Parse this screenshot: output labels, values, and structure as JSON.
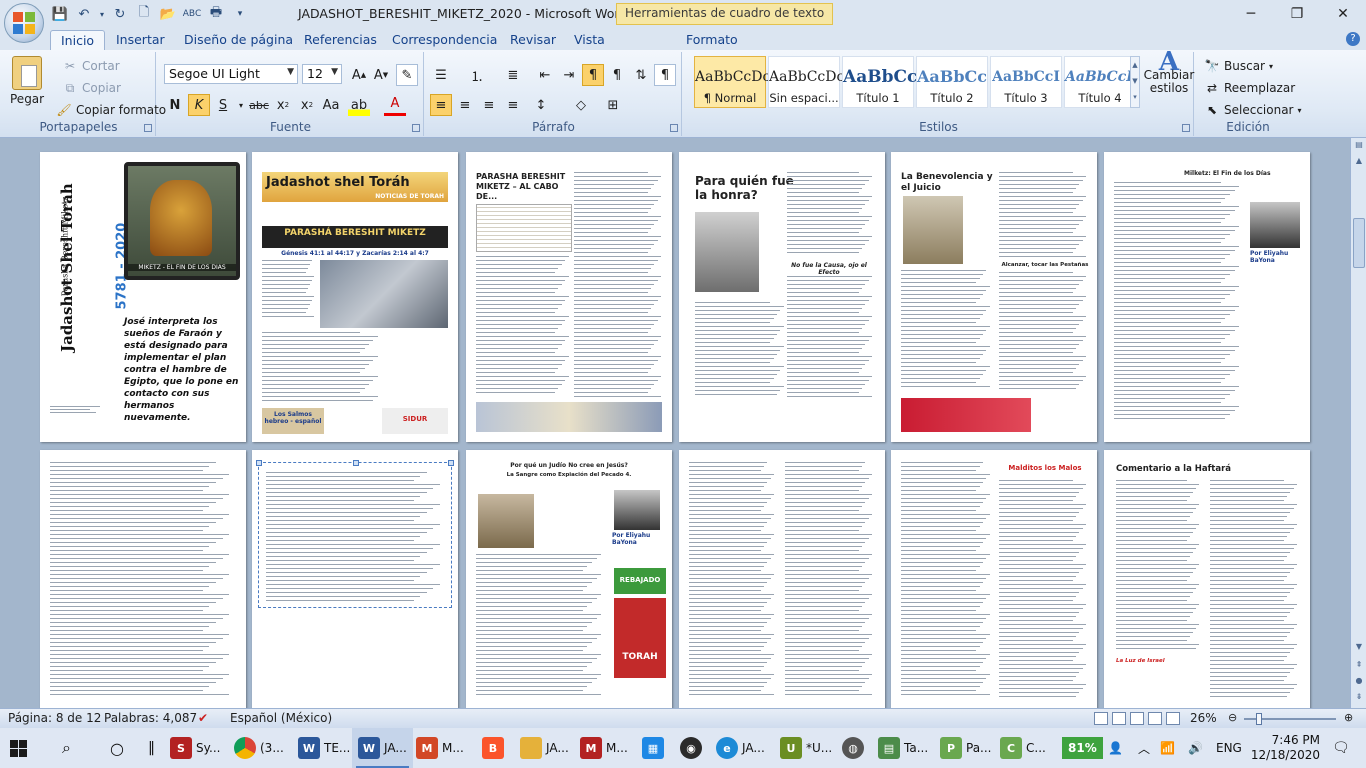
{
  "window": {
    "title": "JADASHOT_BERESHIT_MIKETZ_2020 - Microsoft Word",
    "context_tab_title": "Herramientas de cuadro de texto"
  },
  "tabs": [
    "Inicio",
    "Insertar",
    "Diseño de página",
    "Referencias",
    "Correspondencia",
    "Revisar",
    "Vista",
    "Formato"
  ],
  "ribbon": {
    "clipboard": {
      "label": "Portapapeles",
      "paste": "Pegar",
      "cut": "Cortar",
      "copy": "Copiar",
      "format_painter": "Copiar formato"
    },
    "font": {
      "label": "Fuente",
      "font_name": "Segoe UI Light",
      "font_size": "12"
    },
    "paragraph": {
      "label": "Párrafo"
    },
    "styles": {
      "label": "Estilos",
      "items": [
        {
          "sample": "AaBbCcDc",
          "name": "¶ Normal"
        },
        {
          "sample": "AaBbCcDc",
          "name": "Sin espaci..."
        },
        {
          "sample": "AaBbCc",
          "name": "Título 1"
        },
        {
          "sample": "AaBbCc",
          "name": "Título 2"
        },
        {
          "sample": "AaBbCcI",
          "name": "Título 3"
        },
        {
          "sample": "AaBbCcD",
          "name": "Título 4"
        }
      ],
      "change_styles": "Cambiar estilos"
    },
    "editing": {
      "label": "Edición",
      "find": "Buscar",
      "replace": "Reemplazar",
      "select": "Seleccionar"
    }
  },
  "pages": {
    "p1": {
      "title": "Jadashot Shel Torah",
      "subtitle": "Parasha Bereshit Miketz",
      "year": "5781 - 2020",
      "band": "MIKETZ - EL FIN DE LOS DIAS",
      "caption": "José interpreta los sueños de Faraón y está designado para implementar el plan contra el hambre de Egipto, que lo pone en contacto con sus hermanos nuevamente."
    },
    "p2": {
      "title": "Jadashot shel Toráh",
      "noticias": "NOTICIAS DE TORAH",
      "parasha": "PARASHÁ BERESHIT MIKETZ",
      "ref": "Génesis 41:1 al 44:17 y Zacarías 2:14 al 4:7",
      "ad1": "Los Salmos hebreo - español",
      "ad2": "SIDUR"
    },
    "p3": {
      "title": "PARASHA BERESHIT MIKETZ – AL CABO DE..."
    },
    "p4": {
      "title": "Para quién fue la honra?",
      "sub": "No fue la Causa, ojo el Efecto"
    },
    "p5": {
      "title": "La Benevolencia y el Juicio",
      "sub": "Alcanzar, tocar las Pestañas"
    },
    "p6": {
      "title": "Milketz: El Fin de los Días",
      "author": "Por Eliyahu BaYona"
    },
    "p9": {
      "title": "Por qué un Judío No cree en Jesús?",
      "sub": "La Sangre como Expiación del Pecado 4.",
      "author": "Por Eliyahu BaYona",
      "ad": "REBAJADO",
      "ad2": "TORAH"
    },
    "p11": {
      "title": "Malditos los Malos"
    },
    "p12": {
      "title": "Comentario a la Haftará",
      "sub": "La Luz de Israel"
    }
  },
  "statusbar": {
    "page": "Página: 8 de 12",
    "words": "Palabras: 4,087",
    "language": "Español (México)",
    "zoom": "26%"
  },
  "taskbar": {
    "items": [
      "Sy...",
      "(3...",
      "TE...",
      "JA...",
      "M...",
      "JA...",
      "M...",
      "JA...",
      "*U...",
      "Ta...",
      "Pa...",
      "C..."
    ],
    "battery": "81%",
    "lang": "ENG",
    "time": "7:46 PM",
    "date": "12/18/2020"
  },
  "colors": {
    "ribbon_bg": "#dfe9f5",
    "accent": "#15428b",
    "doc_bg": "#a3b6cc",
    "style_selected": "#fde9a6"
  }
}
